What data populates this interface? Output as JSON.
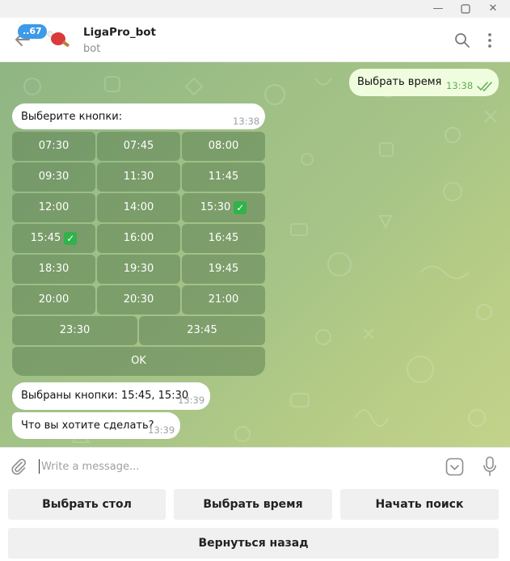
{
  "header": {
    "badge": "..67",
    "title": "LigaPro_bot",
    "subtitle": "bot"
  },
  "messages": {
    "out_text": "Выбрать время",
    "out_time": "13:38",
    "prompt_text": "Выберите кнопки:",
    "prompt_time": "13:38",
    "selected_text": "Выбраны кнопки: 15:45, 15:30",
    "selected_time": "13:39",
    "question_text": "Что вы хотите сделать?",
    "question_time": "13:39"
  },
  "inline_keyboard": [
    [
      "07:30",
      "07:45",
      "08:00"
    ],
    [
      "09:30",
      "11:30",
      "11:45"
    ],
    [
      "12:00",
      "14:00",
      "15:30"
    ],
    [
      "15:45",
      "16:00",
      "16:45"
    ],
    [
      "18:30",
      "19:30",
      "19:45"
    ],
    [
      "20:00",
      "20:30",
      "21:00"
    ],
    [
      "23:30",
      "23:45"
    ],
    [
      "OK"
    ]
  ],
  "check_mark": "✓",
  "composer": {
    "placeholder": "Write a message..."
  },
  "reply_keyboard": {
    "row1": [
      "Выбрать стол",
      "Выбрать время",
      "Начать поиск"
    ],
    "row2": [
      "Вернуться назад"
    ]
  },
  "colors": {
    "accent": "#3d9ae8",
    "outgoing_bubble": "#effdde",
    "read_check": "#62ac55"
  }
}
